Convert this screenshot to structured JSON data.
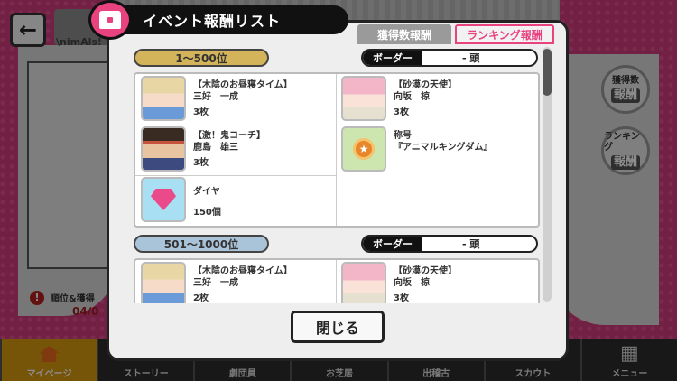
{
  "background": {
    "header_subtitle": "\\nimAls!",
    "notice_title": "順位&獲得",
    "notice_date": "04/0",
    "side_buttons": [
      {
        "top": "獲得数",
        "bottom": "報酬"
      },
      {
        "top": "ランキング",
        "bottom": "報酬"
      }
    ],
    "nav": [
      "マイページ",
      "ストーリー",
      "劇団員",
      "お芝居",
      "出稽古",
      "スカウト",
      "メニュー"
    ]
  },
  "modal": {
    "title": "イベント報酬リスト",
    "tabs": {
      "count": "獲得数報酬",
      "ranking": "ランキング報酬"
    },
    "close_label": "閉じる",
    "sections": [
      {
        "rank": "1〜500位",
        "border_label": "ボーダー",
        "border_value": "- 頭",
        "items": [
          {
            "name1": "【木陰のお昼寝タイム】",
            "name2": "三好　一成",
            "qty": "3枚",
            "icon": "character-card-icon"
          },
          {
            "name1": "【砂漠の天使】",
            "name2": "向坂　椋",
            "qty": "3枚",
            "icon": "character-card-icon"
          },
          {
            "name1": "【激！鬼コーチ】",
            "name2": "鹿島　雄三",
            "qty": "3枚",
            "icon": "character-card-icon"
          },
          {
            "name1": "称号",
            "name2": "『アニマルキングダム』",
            "qty": "",
            "icon": "title-badge-icon"
          },
          {
            "name1": "ダイヤ",
            "name2": "",
            "qty": "150個",
            "icon": "diamond-icon"
          }
        ]
      },
      {
        "rank": "501〜1000位",
        "border_label": "ボーダー",
        "border_value": "- 頭",
        "items": [
          {
            "name1": "【木陰のお昼寝タイム】",
            "name2": "三好　一成",
            "qty": "2枚",
            "icon": "character-card-icon"
          },
          {
            "name1": "【砂漠の天使】",
            "name2": "向坂　椋",
            "qty": "3枚",
            "icon": "character-card-icon"
          }
        ]
      }
    ]
  }
}
